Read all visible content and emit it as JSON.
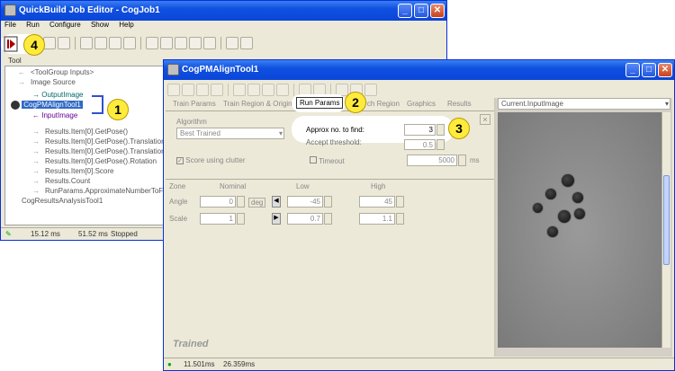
{
  "main_window": {
    "title": "QuickBuild Job Editor - CogJob1",
    "menu": [
      "File",
      "Run",
      "Configure",
      "Show",
      "Help"
    ],
    "tool_label": "Tool",
    "tree": [
      {
        "text": "<ToolGroup Inputs>",
        "arrow": "←"
      },
      {
        "text": "Image Source",
        "arrow": "→"
      },
      {
        "text": "OutputImage",
        "arrow": "→"
      },
      {
        "text": "CogPMAlignTool1",
        "arrow": ""
      },
      {
        "text": "InputImage",
        "arrow": "←"
      },
      {
        "text": "Results.Item[0].GetPose()",
        "arrow": "→"
      },
      {
        "text": "Results.Item[0].GetPose().Translation",
        "arrow": "→"
      },
      {
        "text": "Results.Item[0].GetPose().Translation",
        "arrow": "→"
      },
      {
        "text": "Results.Item[0].GetPose().Rotation",
        "arrow": "→"
      },
      {
        "text": "Results.Item[0].Score",
        "arrow": "→"
      },
      {
        "text": "Results.Count",
        "arrow": "→"
      },
      {
        "text": "RunParams.ApproximateNumberToFind",
        "arrow": "→"
      },
      {
        "text": "CogResultsAnalysisTool1",
        "arrow": ""
      }
    ],
    "status": {
      "time1": "15.12 ms",
      "time2": "51.52 ms",
      "state": "Stopped"
    }
  },
  "tool_window": {
    "title": "CogPMAlignTool1",
    "tabs": [
      "Train Params",
      "Train Region & Origin",
      "Run Params",
      "Search Region",
      "Graphics",
      "Results"
    ],
    "algorithm_label": "Algorithm",
    "algorithm_value": "Best Trained",
    "approx_label": "Approx no. to find:",
    "approx_value": "3",
    "accept_label": "Accept threshold:",
    "accept_value": "0.5",
    "score_clutter_label": "Score using clutter",
    "timeout_label": "Timeout",
    "timeout_value": "5000",
    "timeout_unit": "ms",
    "close_x": "×",
    "zone_header": {
      "zone": "Zone",
      "nominal": "Nominal",
      "low": "Low",
      "high": "High"
    },
    "angle": {
      "label": "Angle",
      "nominal": "0",
      "unit": "deg",
      "low": "-45",
      "high": "45"
    },
    "scale": {
      "label": "Scale",
      "nominal": "1",
      "low": "0.7",
      "high": "1.1"
    },
    "trained_label": "Trained",
    "image_dropdown": "Current.InputImage",
    "status": {
      "time1": "11.501ms",
      "time2": "26.359ms"
    }
  },
  "callouts": {
    "c1": "1",
    "c2": "2",
    "c3": "3",
    "c4": "4"
  }
}
